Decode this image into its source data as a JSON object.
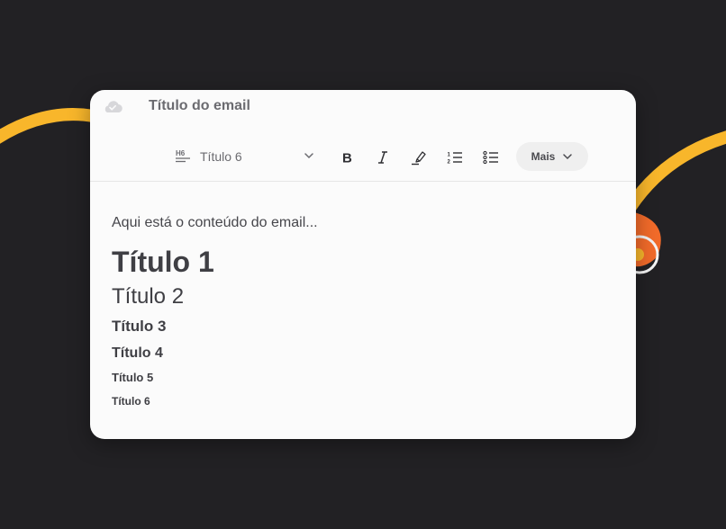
{
  "editor": {
    "subject_placeholder": "Título do email",
    "cloud_icon": "cloud-check-icon"
  },
  "toolbar": {
    "heading_select": {
      "icon": "h6-icon",
      "value": "Título 6"
    },
    "buttons": [
      {
        "name": "bold",
        "icon": "bold-icon"
      },
      {
        "name": "italic",
        "icon": "italic-icon"
      },
      {
        "name": "highlight",
        "icon": "highlighter-icon"
      },
      {
        "name": "ordered-list",
        "icon": "ordered-list-icon"
      },
      {
        "name": "bullet-list",
        "icon": "bullet-list-icon"
      }
    ],
    "more_label": "Mais"
  },
  "content": {
    "paragraph": "Aqui está o conteúdo do email...",
    "h1": "Título 1",
    "h2": "Título 2",
    "h3": "Título 3",
    "h4": "Título 4",
    "h5": "Título 5",
    "h6": "Título 6"
  },
  "colors": {
    "background": "#222124",
    "card": "#fbfbfb",
    "accent_yellow": "#f8b62b",
    "accent_orange": "#f26b2a"
  }
}
